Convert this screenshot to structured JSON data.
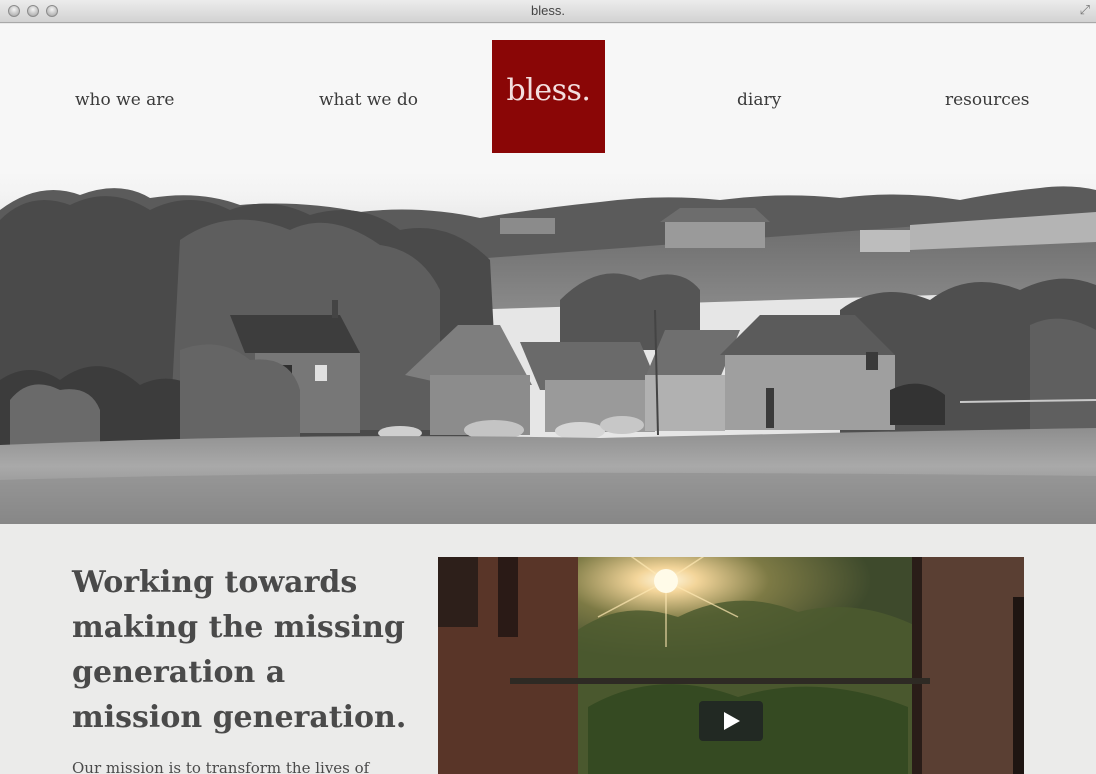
{
  "window": {
    "title": "bless."
  },
  "nav": {
    "who_we_are": "who we are",
    "what_we_do": "what we do",
    "logo": "bless.",
    "diary": "diary",
    "resources": "resources"
  },
  "colors": {
    "brand": "#8a0606",
    "text": "#3b3b3b",
    "background": "#ebebea"
  },
  "hero": {
    "image": "black-and-white photo of farmhouses in a meadow"
  },
  "content": {
    "tagline_lines": [
      "Working towards",
      "making the missing",
      "generation a",
      "mission generation."
    ],
    "mission_text": "Our mission is to transform the lives of"
  },
  "video": {
    "play_icon": "play-icon"
  }
}
